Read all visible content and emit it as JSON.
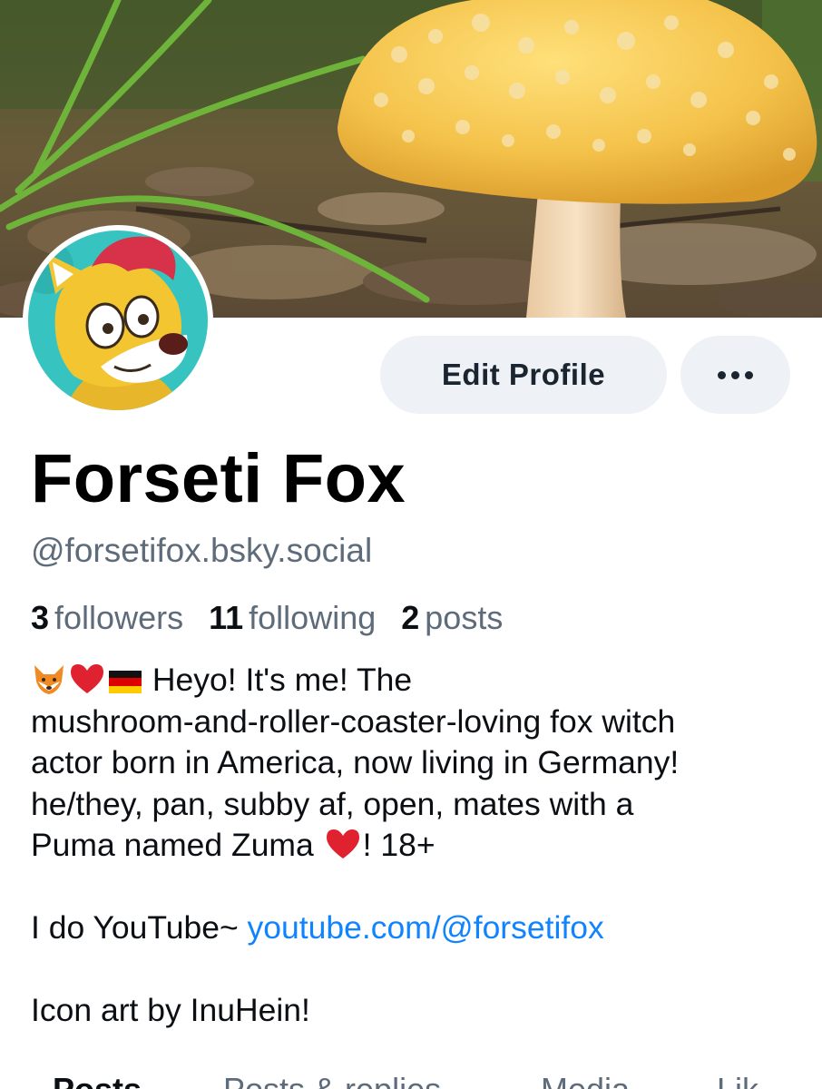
{
  "profile": {
    "display_name": "Forseti Fox",
    "handle": "@forsetifox.bsky.social"
  },
  "actions": {
    "edit_profile_label": "Edit Profile",
    "more_icon": "more-horizontal-icon"
  },
  "stats": {
    "followers_count": "3",
    "followers_label": "followers",
    "following_count": "11",
    "following_label": "following",
    "posts_count": "2",
    "posts_label": "posts"
  },
  "bio": {
    "emojis": [
      "fox-emoji",
      "red-heart-emoji",
      "germany-flag-emoji"
    ],
    "line1": " Heyo! It's me! The",
    "line2": "mushroom-and-roller-coaster-loving fox witch",
    "line3": "actor born in America, now living in Germany!",
    "line4": "he/they, pan, subby af, open, mates with a",
    "line5_before": "Puma named Zuma ",
    "line5_after": "!  18+",
    "youtube_prefix": "I do YouTube~ ",
    "youtube_link": "youtube.com/@forsetifox",
    "credit": "Icon art by InuHein!"
  },
  "tabs": [
    "Posts",
    "Posts & replies",
    "Media",
    "Lik"
  ],
  "colors": {
    "link": "#1083fe",
    "muted_text": "#5d6b7a",
    "button_bg": "#eef1f5"
  }
}
